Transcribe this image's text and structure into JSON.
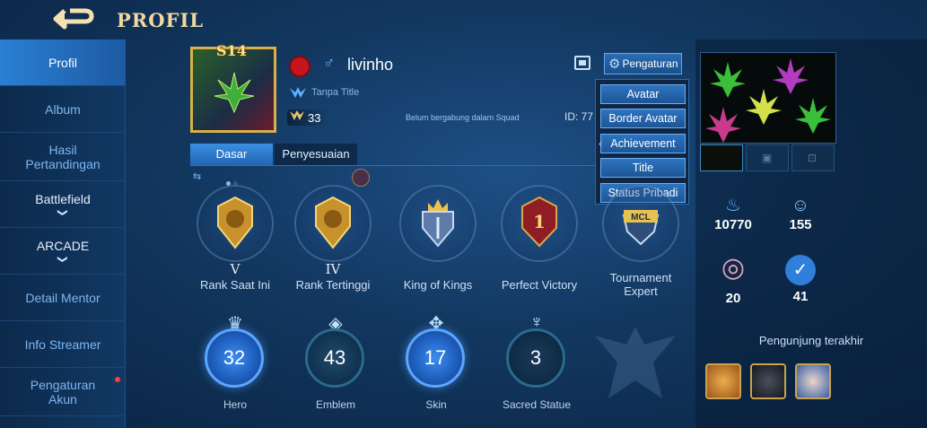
{
  "header": {
    "title": "PROFIL",
    "back_icon": "back-arrow-icon"
  },
  "sidebar": {
    "items": [
      {
        "label": "Profil",
        "active": true
      },
      {
        "label": "Album"
      },
      {
        "label": "Hasil Pertandingan"
      },
      {
        "label": "Battlefield",
        "has_chevron": true
      },
      {
        "label": "ARCADE",
        "has_chevron": true
      },
      {
        "label": "Detail Mentor"
      },
      {
        "label": "Info Streamer"
      },
      {
        "label": "Pengaturan Akun",
        "notification": true
      }
    ],
    "chevron": "❯"
  },
  "profile": {
    "season_badge": "S14",
    "name": "livinho",
    "gender_symbol": "♂",
    "title": "Tanpa Title",
    "level": "33",
    "squad": "Belum bergabung dalam Squad",
    "id": "ID: 77"
  },
  "settings": {
    "label": "Pengaturan",
    "menu": [
      "Avatar",
      "Border Avatar",
      "Achievement",
      "Title",
      "Status Pribadi"
    ]
  },
  "tabs": [
    {
      "label": "Dasar",
      "active": true
    },
    {
      "label": "Penyesuaian",
      "active": false
    }
  ],
  "ranks": [
    {
      "roman": "V",
      "label": "Rank Saat Ini"
    },
    {
      "roman": "IV",
      "label": "Rank Tertinggi"
    },
    {
      "roman": "",
      "label": "King of Kings"
    },
    {
      "roman": "",
      "label": "Perfect Victory"
    },
    {
      "roman": "",
      "label": "Tournament Expert",
      "emblem_text": "MCL"
    }
  ],
  "stats": [
    {
      "value": "32",
      "label": "Hero",
      "icon": "hero-icon",
      "lit": true
    },
    {
      "value": "43",
      "label": "Emblem",
      "icon": "emblem-icon",
      "lit": false
    },
    {
      "value": "17",
      "label": "Skin",
      "icon": "skin-icon",
      "lit": true
    },
    {
      "value": "3",
      "label": "Sacred Statue",
      "icon": "statue-icon",
      "lit": false
    }
  ],
  "right_panel": {
    "popularity": "10770",
    "followers": "155",
    "relationship": "20",
    "likes": "41",
    "visitors_label": "Pengunjung terakhir"
  },
  "colors": {
    "accent": "#2a7fd4",
    "gold": "#d8b048",
    "title_gold": "#f2d7a0"
  }
}
